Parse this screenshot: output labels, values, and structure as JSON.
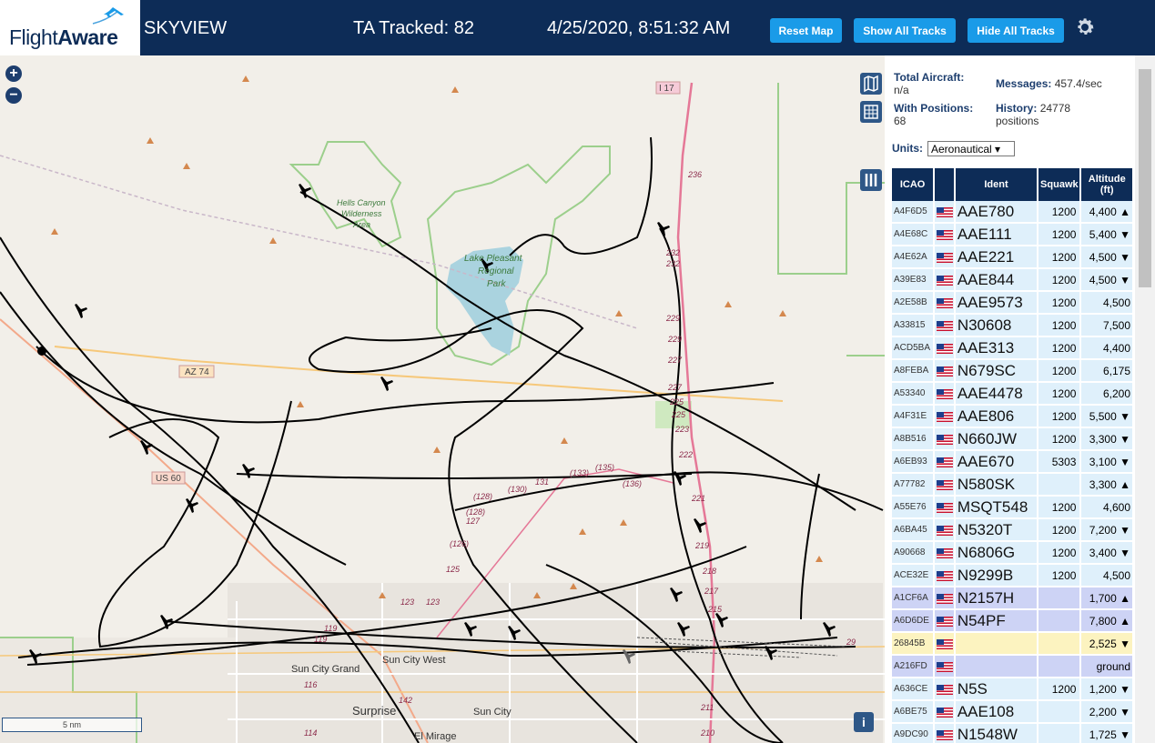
{
  "brand": {
    "logo_text_1": "Flight",
    "logo_text_2": "Aware"
  },
  "header": {
    "app_title": "SKYVIEW",
    "ta_tracked": "TA Tracked: 82",
    "datetime": "4/25/2020, 8:51:32 AM",
    "reset_map": "Reset Map",
    "show_all_tracks": "Show All Tracks",
    "hide_all_tracks": "Hide All Tracks"
  },
  "map": {
    "zoom_in": "+",
    "zoom_out": "−",
    "scale_label": "5 nm",
    "info": "i",
    "labels": {
      "hells_canyon": "Hells Canyon",
      "wilderness": "Wilderness",
      "area": "Area",
      "lake": "Lake Pleasant",
      "regional": "Regional",
      "park": "Park",
      "az74": "AZ 74",
      "us60": "US 60",
      "i17": "I 17",
      "sun_city_west": "Sun City West",
      "sun_city_grand": "Sun City Grand",
      "surprise": "Surprise",
      "sun_city": "Sun City",
      "el_mirage": "El Mirage",
      "m236": "236",
      "m232": "232",
      "m229": "229",
      "m227": "227",
      "m225": "225",
      "m223": "223",
      "m222": "222",
      "m221": "221",
      "m219": "219",
      "m218": "218",
      "m217": "217",
      "m215": "215",
      "m131": "131",
      "m133": "(133)",
      "m135": "(135)",
      "m136": "(136)",
      "m130": "(130)",
      "m128": "(128)",
      "m127": "127",
      "m126": "(126)",
      "m125": "125",
      "m123": "123",
      "m119": "119",
      "m142": "142",
      "m116": "116",
      "m114": "114",
      "m211": "211",
      "m210": "210",
      "m29": "29"
    }
  },
  "panel": {
    "total_aircraft_label": "Total Aircraft:",
    "total_aircraft_value": "n/a",
    "with_positions_label": "With Positions:",
    "with_positions_value": "68",
    "messages_label": "Messages:",
    "messages_value": "457.4/sec",
    "history_label": "History:",
    "history_value": "24778",
    "history_unit": "positions",
    "units_label": "Units:",
    "units_value": "Aeronautical ▾"
  },
  "table": {
    "headers": [
      "ICAO",
      "",
      "Ident",
      "Squawk",
      "Altitude (ft)"
    ],
    "rows": [
      {
        "icao": "A4F6D5",
        "ident": "AAE780",
        "squawk": "1200",
        "alt": "4,400 ▲",
        "style": "r0"
      },
      {
        "icao": "A4E68C",
        "ident": "AAE111",
        "squawk": "1200",
        "alt": "5,400 ▼",
        "style": "r0"
      },
      {
        "icao": "A4E62A",
        "ident": "AAE221",
        "squawk": "1200",
        "alt": "4,500 ▼",
        "style": "r0"
      },
      {
        "icao": "A39E83",
        "ident": "AAE844",
        "squawk": "1200",
        "alt": "4,500 ▼",
        "style": "r0"
      },
      {
        "icao": "A2E58B",
        "ident": "AAE9573",
        "squawk": "1200",
        "alt": "4,500",
        "style": "r0"
      },
      {
        "icao": "A33815",
        "ident": "N30608",
        "squawk": "1200",
        "alt": "7,500",
        "style": "r0"
      },
      {
        "icao": "ACD5BA",
        "ident": "AAE313",
        "squawk": "1200",
        "alt": "4,400",
        "style": "r0"
      },
      {
        "icao": "A8FEBA",
        "ident": "N679SC",
        "squawk": "1200",
        "alt": "6,175",
        "style": "r0"
      },
      {
        "icao": "A53340",
        "ident": "AAE4478",
        "squawk": "1200",
        "alt": "6,200",
        "style": "r0"
      },
      {
        "icao": "A4F31E",
        "ident": "AAE806",
        "squawk": "1200",
        "alt": "5,500 ▼",
        "style": "r0"
      },
      {
        "icao": "A8B516",
        "ident": "N660JW",
        "squawk": "1200",
        "alt": "3,300 ▼",
        "style": "r0"
      },
      {
        "icao": "A6EB93",
        "ident": "AAE670",
        "squawk": "5303",
        "alt": "3,100 ▼",
        "style": "r0"
      },
      {
        "icao": "A77782",
        "ident": "N580SK",
        "squawk": "",
        "alt": "3,300 ▲",
        "style": "r0"
      },
      {
        "icao": "A55E76",
        "ident": "MSQT548",
        "squawk": "1200",
        "alt": "4,600",
        "style": "r0"
      },
      {
        "icao": "A6BA45",
        "ident": "N5320T",
        "squawk": "1200",
        "alt": "7,200 ▼",
        "style": "r0"
      },
      {
        "icao": "A90668",
        "ident": "N6806G",
        "squawk": "1200",
        "alt": "3,400 ▼",
        "style": "r0"
      },
      {
        "icao": "ACE32E",
        "ident": "N9299B",
        "squawk": "1200",
        "alt": "4,500",
        "style": "r0"
      },
      {
        "icao": "A1CF6A",
        "ident": "N2157H",
        "squawk": "",
        "alt": "1,700 ▲",
        "style": "r1"
      },
      {
        "icao": "A6D6DE",
        "ident": "N54PF",
        "squawk": "",
        "alt": "7,800 ▲",
        "style": "r1"
      },
      {
        "icao": "26845B",
        "ident": "",
        "squawk": "",
        "alt": "2,525 ▼",
        "style": "r2"
      },
      {
        "icao": "A216FD",
        "ident": "",
        "squawk": "",
        "alt": "ground",
        "style": "r1"
      },
      {
        "icao": "A636CE",
        "ident": "N5S",
        "squawk": "1200",
        "alt": "1,200 ▼",
        "style": "r3"
      },
      {
        "icao": "A6BE75",
        "ident": "AAE108",
        "squawk": "",
        "alt": "2,200 ▼",
        "style": "r3"
      },
      {
        "icao": "A9DC90",
        "ident": "N1548W",
        "squawk": "",
        "alt": "1,725 ▼",
        "style": "r3"
      }
    ]
  }
}
